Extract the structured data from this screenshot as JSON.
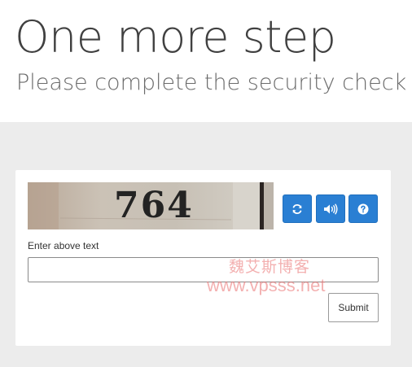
{
  "page": {
    "title": "One more step",
    "subtitle": "Please complete the security check t"
  },
  "captcha": {
    "image_text": "764",
    "refresh_icon": "refresh-icon",
    "audio_icon": "speaker-icon",
    "help_icon": "question-icon",
    "accent_color": "#2a7fd3"
  },
  "form": {
    "label": "Enter above text",
    "input_value": "",
    "submit_label": "Submit"
  },
  "watermark": {
    "line1": "魏艾斯博客",
    "line2": "www.vpsss.net"
  }
}
